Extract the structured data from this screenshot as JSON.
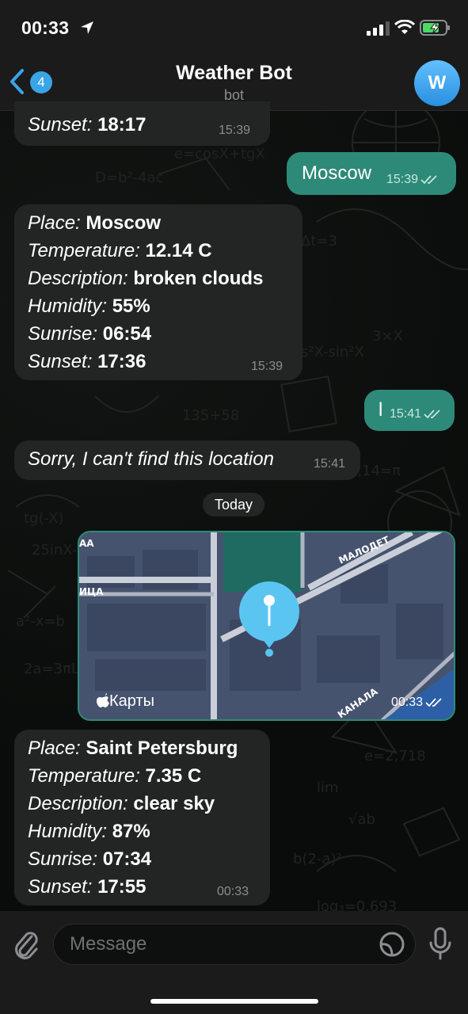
{
  "status_bar": {
    "time": "00:33"
  },
  "header": {
    "back_badge": "4",
    "title": "Weather Bot",
    "subtitle": "bot",
    "avatar_letter": "W"
  },
  "messages": [
    {
      "kind": "bot",
      "lines": [
        {
          "label": "Sunset:",
          "value": "18:17"
        }
      ],
      "time": "15:39"
    },
    {
      "kind": "user",
      "text": "Moscow",
      "time": "15:39"
    },
    {
      "kind": "bot",
      "lines": [
        {
          "label": "Place:",
          "value": "Moscow"
        },
        {
          "label": "Temperature:",
          "value": "12.14 C"
        },
        {
          "label": "Description:",
          "value": "broken clouds"
        },
        {
          "label": "Humidity:",
          "value": "55%"
        },
        {
          "label": "Sunrise:",
          "value": "06:54"
        },
        {
          "label": "Sunset:",
          "value": "17:36"
        }
      ],
      "time": "15:39"
    },
    {
      "kind": "user",
      "text": "l",
      "time": "15:41"
    },
    {
      "kind": "bot",
      "text": "Sorry, I can't find this location",
      "time": "15:41"
    },
    {
      "kind": "date",
      "text": "Today"
    },
    {
      "kind": "location",
      "map_label": "Карты",
      "street_1": "МАЛОДЕТ",
      "street_2": "ИЦА",
      "street_3": "КАНАЛА",
      "corner_label": "АА",
      "time": "00:33"
    },
    {
      "kind": "bot",
      "lines": [
        {
          "label": "Place:",
          "value": "Saint Petersburg"
        },
        {
          "label": "Temperature:",
          "value": "7.35 C"
        },
        {
          "label": "Description:",
          "value": "clear sky"
        },
        {
          "label": "Humidity:",
          "value": "87%"
        },
        {
          "label": "Sunrise:",
          "value": "07:34"
        },
        {
          "label": "Sunset:",
          "value": "17:55"
        }
      ],
      "time": "00:33"
    }
  ],
  "input": {
    "placeholder": "Message"
  },
  "colors": {
    "accent": "#3aa5e6",
    "outgoing": "#2e8a78",
    "incoming": "#222524"
  }
}
